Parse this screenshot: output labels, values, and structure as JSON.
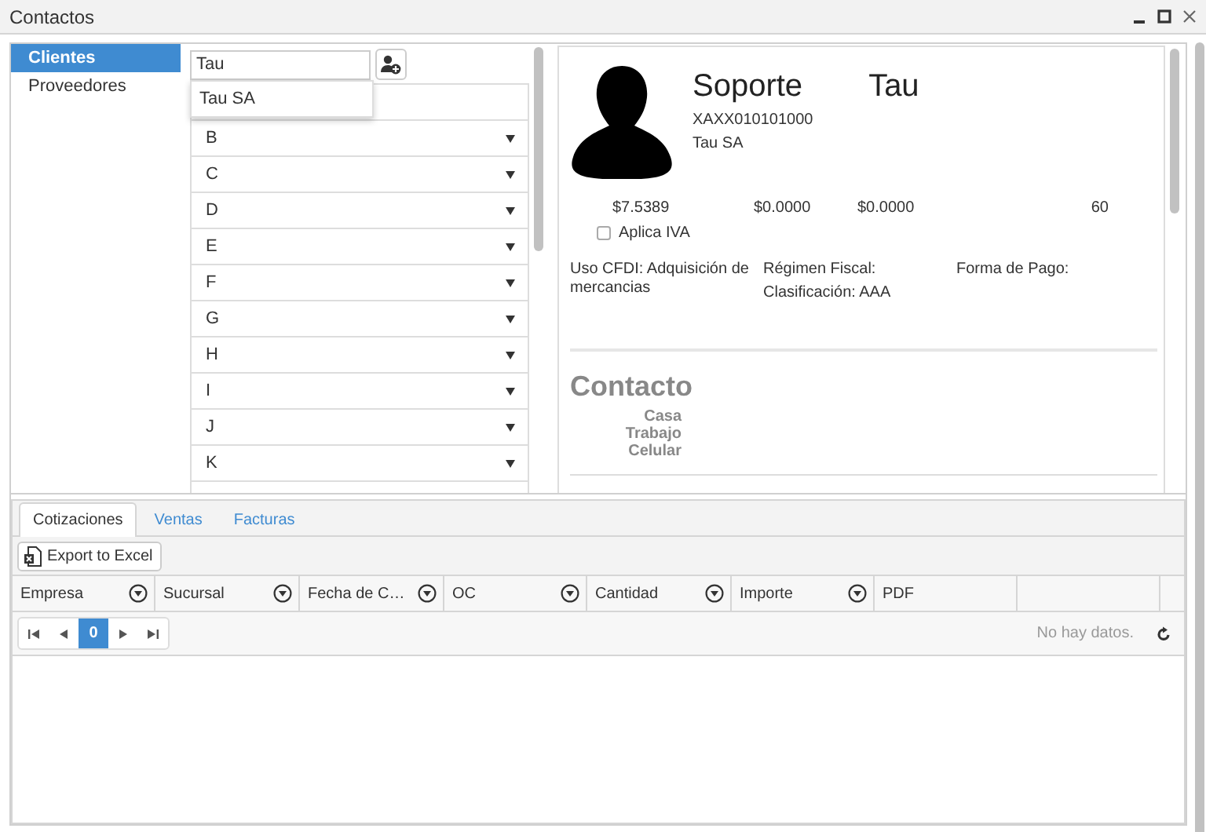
{
  "window": {
    "title": "Contactos"
  },
  "sidebar": {
    "items": [
      {
        "label": "Clientes",
        "selected": true
      },
      {
        "label": "Proveedores",
        "selected": false
      }
    ]
  },
  "search": {
    "value": "Tau",
    "suggestions": [
      "Tau SA"
    ]
  },
  "letter_groups": [
    "B",
    "C",
    "D",
    "E",
    "F",
    "G",
    "H",
    "I",
    "J",
    "K"
  ],
  "contact": {
    "first_name": "Soporte",
    "last_name": "Tau",
    "rfc": "XAXX010101000",
    "company": "Tau SA",
    "amounts": [
      "$7.5389",
      "$0.0000",
      "$0.0000",
      "60"
    ],
    "aplica_iva": {
      "label": "Aplica IVA",
      "checked": false
    },
    "info_columns": [
      [
        "Uso CFDI: Adquisición de mercancias"
      ],
      [
        "Régimen Fiscal:",
        "Clasificación: AAA"
      ],
      [
        "Forma de Pago:"
      ]
    ]
  },
  "contacto": {
    "heading": "Contacto",
    "phones": [
      "Casa",
      "Trabajo",
      "Celular"
    ]
  },
  "tabs": [
    {
      "label": "Cotizaciones",
      "selected": true
    },
    {
      "label": "Ventas",
      "selected": false
    },
    {
      "label": "Facturas",
      "selected": false
    }
  ],
  "toolbar": {
    "export_label": "Export to Excel"
  },
  "table": {
    "columns": [
      {
        "label": "Empresa",
        "filter": true
      },
      {
        "label": "Sucursal",
        "filter": true
      },
      {
        "label": "Fecha de C…",
        "filter": true
      },
      {
        "label": "OC",
        "filter": true
      },
      {
        "label": "Cantidad",
        "filter": true
      },
      {
        "label": "Importe",
        "filter": true
      },
      {
        "label": "PDF",
        "filter": false
      }
    ]
  },
  "pager": {
    "page": "0"
  },
  "empty_message": "No hay datos."
}
